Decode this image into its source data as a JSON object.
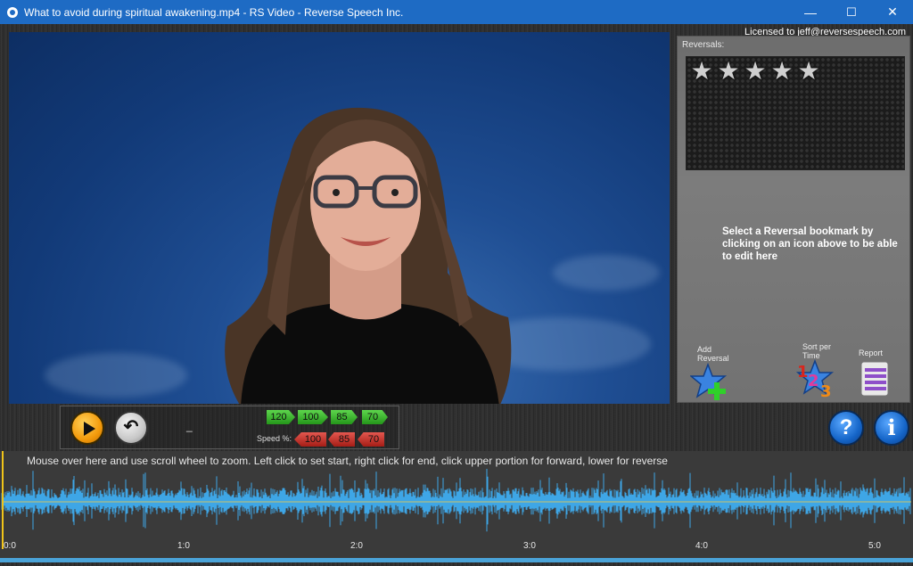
{
  "window": {
    "title": "What to avoid during spiritual awakening.mp4 - RS Video - Reverse Speech Inc.",
    "minimize": "—",
    "maximize": "☐",
    "close": "✕"
  },
  "license": "Licensed to jeff@reversespeech.com",
  "reversals_panel": {
    "label": "Reversals:",
    "rating_stars": 5,
    "hint": "Select a Reversal bookmark by clicking on an icon above to be able to edit here",
    "add_reversal_label": "Add Reversal",
    "sort_label": "Sort per Time",
    "report_label": "Report"
  },
  "controls": {
    "position_text": "_",
    "speed_label": "Speed %:",
    "forward_speeds": [
      "120",
      "100",
      "85",
      "70"
    ],
    "reverse_speeds": [
      "100",
      "85",
      "70"
    ]
  },
  "waveform": {
    "hint": "Mouse over here and use scroll wheel to zoom. Left click to set start, right click for end, click upper portion for forward, lower for reverse",
    "ticks": [
      "0:0",
      "1:0",
      "2:0",
      "3:0",
      "4:0",
      "5:0"
    ],
    "wave_color": "#3ea6e6"
  },
  "icons": {
    "app": "rs-video-icon",
    "play": "play-icon",
    "loop": "loop-back-icon",
    "help": "help-icon",
    "info": "info-icon"
  }
}
